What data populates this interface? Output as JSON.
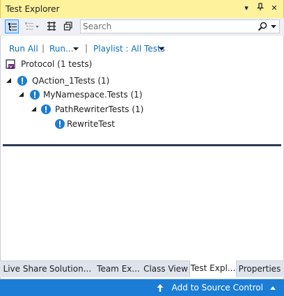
{
  "window": {
    "title": "Test Explorer"
  },
  "titlebar_buttons": [
    {
      "icon": "dropdown-arrow-icon",
      "glyph": "▾"
    },
    {
      "icon": "pin-icon",
      "glyph": "⊥"
    },
    {
      "icon": "close-icon",
      "glyph": "✕"
    }
  ],
  "toolbar": {
    "tools": [
      "group-by-icon",
      "group-options-icon",
      "column-options-icon",
      "collapse-all-icon"
    ],
    "search": {
      "value": "",
      "placeholder": "Search"
    }
  },
  "actions": {
    "run_all": "Run All",
    "run": "Run...",
    "playlist": "Playlist : All Tests"
  },
  "tree": {
    "project": "Protocol (1 tests)",
    "nodes": [
      {
        "label": "QAction_1Tests (1)",
        "status": "not-run"
      },
      {
        "label": "MyNamespace.Tests (1)",
        "status": "not-run"
      },
      {
        "label": "PathRewriterTests (1)",
        "status": "not-run"
      },
      {
        "label": "RewriteTest",
        "status": "not-run"
      }
    ]
  },
  "bottom_tabs": [
    {
      "label": "Live Share",
      "active": false
    },
    {
      "label": "Solution...",
      "active": false
    },
    {
      "label": "Team Ex...",
      "active": false
    },
    {
      "label": "Class View",
      "active": false
    },
    {
      "label": "Test Expl...",
      "active": true
    },
    {
      "label": "Properties",
      "active": false
    }
  ],
  "statusbar": {
    "source_control": "Add to Source Control"
  },
  "colors": {
    "titlebar_bg": "#fff29d",
    "accent_link": "#0e70c0",
    "status_icon": "#1b7dd6",
    "statusbar_bg": "#1b7dd6"
  }
}
